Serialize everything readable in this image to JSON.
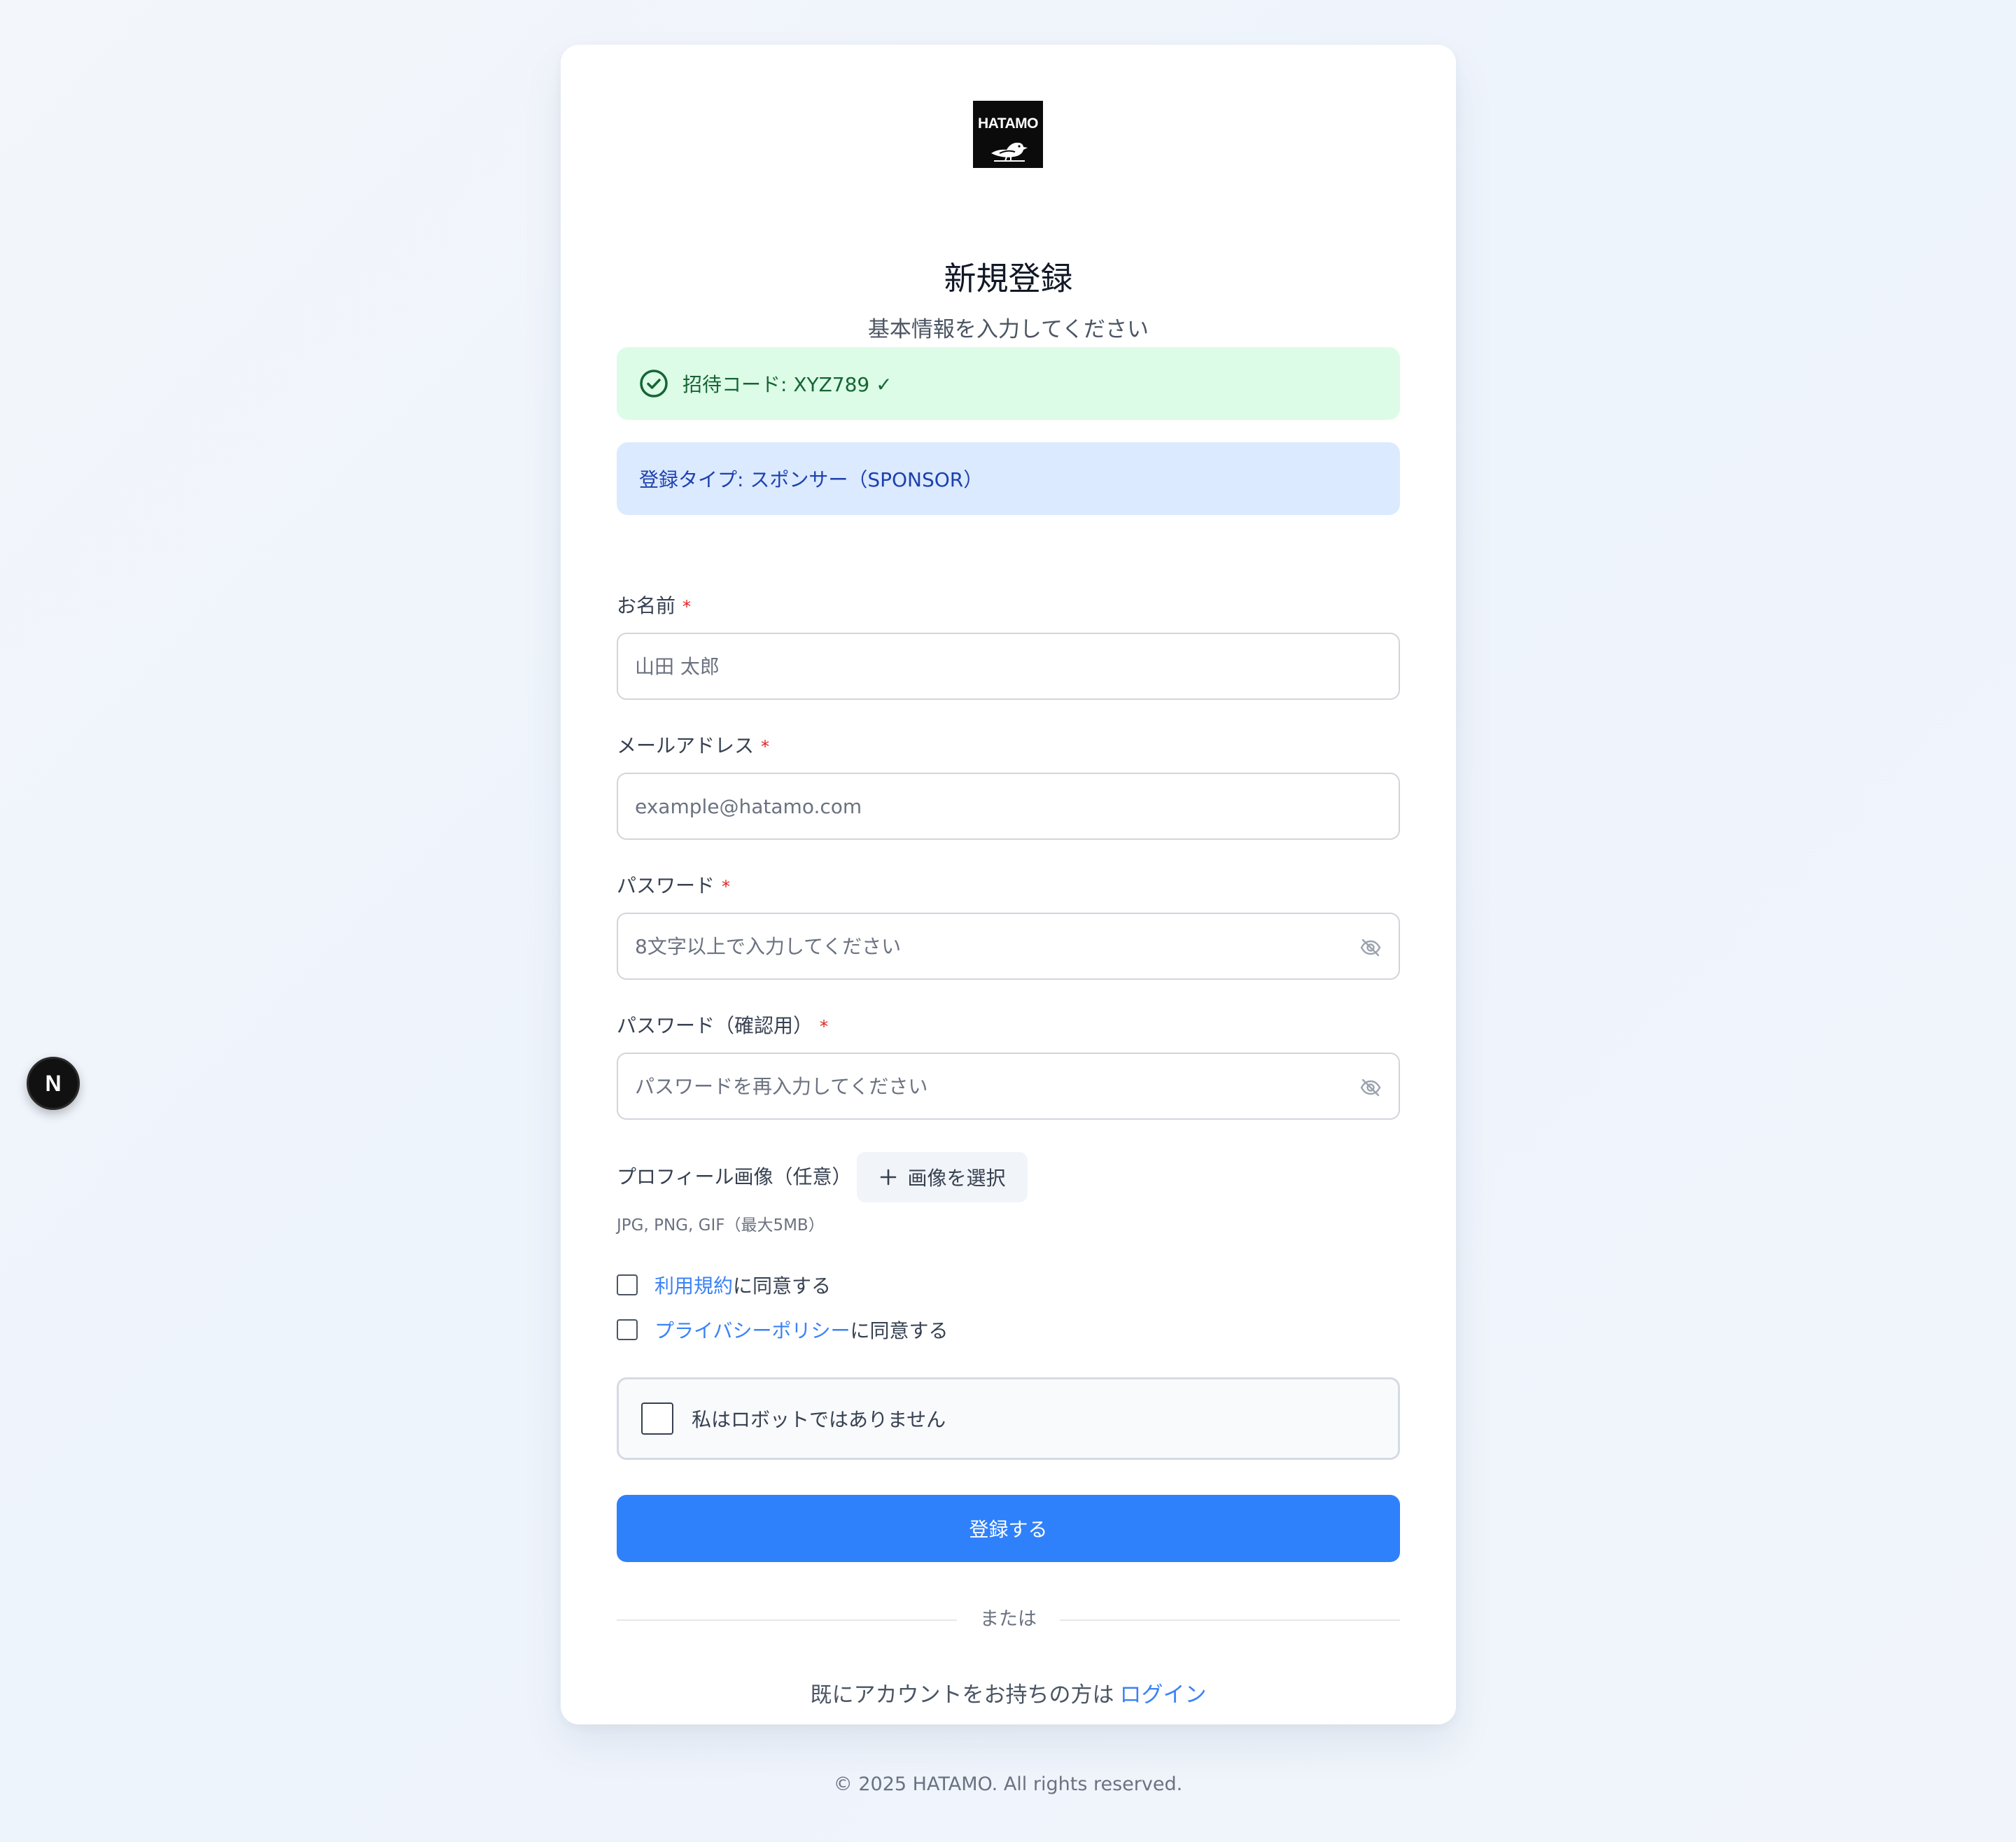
{
  "brand": {
    "logo_text": "HATAMO"
  },
  "header": {
    "title": "新規登録",
    "subtitle": "基本情報を入力してください"
  },
  "invite_banner": {
    "text": "招待コード: XYZ789 ✓",
    "icon": "check-circle-icon",
    "bg": "#dcfce7",
    "color": "#166534"
  },
  "type_banner": {
    "text": "登録タイプ: スポンサー（SPONSOR）",
    "bg": "#dbeafe",
    "color": "#1e40af"
  },
  "form": {
    "name": {
      "label": "お名前",
      "required_mark": "*",
      "placeholder": "山田 太郎",
      "value": ""
    },
    "email": {
      "label": "メールアドレス",
      "required_mark": "*",
      "placeholder": "example@hatamo.com",
      "value": ""
    },
    "password": {
      "label": "パスワード",
      "required_mark": "*",
      "placeholder": "8文字以上で入力してください",
      "value": "",
      "icon": "eye-off-icon"
    },
    "password_confirm": {
      "label": "パスワード（確認用）",
      "required_mark": "*",
      "placeholder": "パスワードを再入力してください",
      "value": "",
      "icon": "eye-off-icon"
    },
    "profile_image": {
      "label": "プロフィール画像（任意）",
      "button_label": "画像を選択",
      "button_icon": "plus-icon",
      "hint": "JPG, PNG, GIF（最大5MB）"
    },
    "terms": {
      "link_text": "利用規約",
      "suffix": "に同意する",
      "checked": false
    },
    "privacy": {
      "link_text": "プライバシーポリシー",
      "suffix": "に同意する",
      "checked": false
    },
    "captcha": {
      "label": "私はロボットではありません",
      "checked": false
    },
    "submit_label": "登録する"
  },
  "divider": {
    "text": "または"
  },
  "login": {
    "prefix": "既にアカウントをお持ちの方は",
    "link_text": "ログイン"
  },
  "footer": {
    "text": "© 2025 HATAMO. All rights reserved."
  },
  "dev_badge": {
    "text": "N"
  },
  "colors": {
    "accent": "#2f80fb",
    "link": "#3b82f6",
    "required": "#dc2626"
  }
}
